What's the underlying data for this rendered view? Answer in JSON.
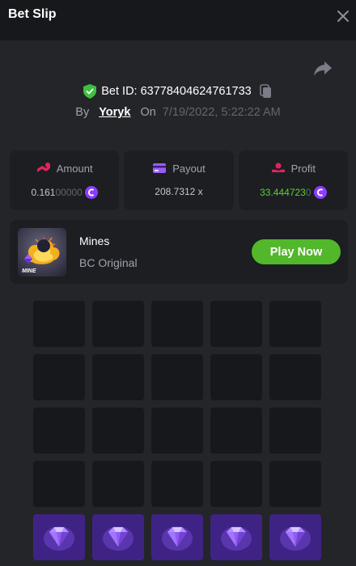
{
  "header": {
    "title": "Bet Slip"
  },
  "bet": {
    "id_label": "Bet ID: 63778404624761733",
    "by_label": "By",
    "user": "Yoryk",
    "on_label": "On",
    "date": "7/19/2022, 5:22:22 AM"
  },
  "stats": {
    "amount": {
      "label": "Amount",
      "value_main": "0.161",
      "value_dim": "00000"
    },
    "payout": {
      "label": "Payout",
      "value": "208.7312 x"
    },
    "profit": {
      "label": "Profit",
      "value_main": "33.444723",
      "value_dim": "0"
    }
  },
  "game": {
    "name": "Mines",
    "subtitle": "BC Original",
    "play_label": "Play Now",
    "thumb_text": "MINE"
  },
  "grid": {
    "rows": [
      [
        "hidden",
        "hidden",
        "hidden",
        "hidden",
        "hidden"
      ],
      [
        "hidden",
        "hidden",
        "hidden",
        "hidden",
        "hidden"
      ],
      [
        "hidden",
        "hidden",
        "hidden",
        "hidden",
        "hidden"
      ],
      [
        "hidden",
        "hidden",
        "hidden",
        "hidden",
        "hidden"
      ],
      [
        "gem",
        "gem",
        "gem",
        "gem",
        "gem"
      ]
    ]
  },
  "colors": {
    "background": "#17181b",
    "panel": "#232529",
    "card": "#1c1e22",
    "accent_green": "#5bd22e",
    "play_button": "#52b72a",
    "gem_cell": "#3f2384",
    "coin": "#8a3dff"
  }
}
